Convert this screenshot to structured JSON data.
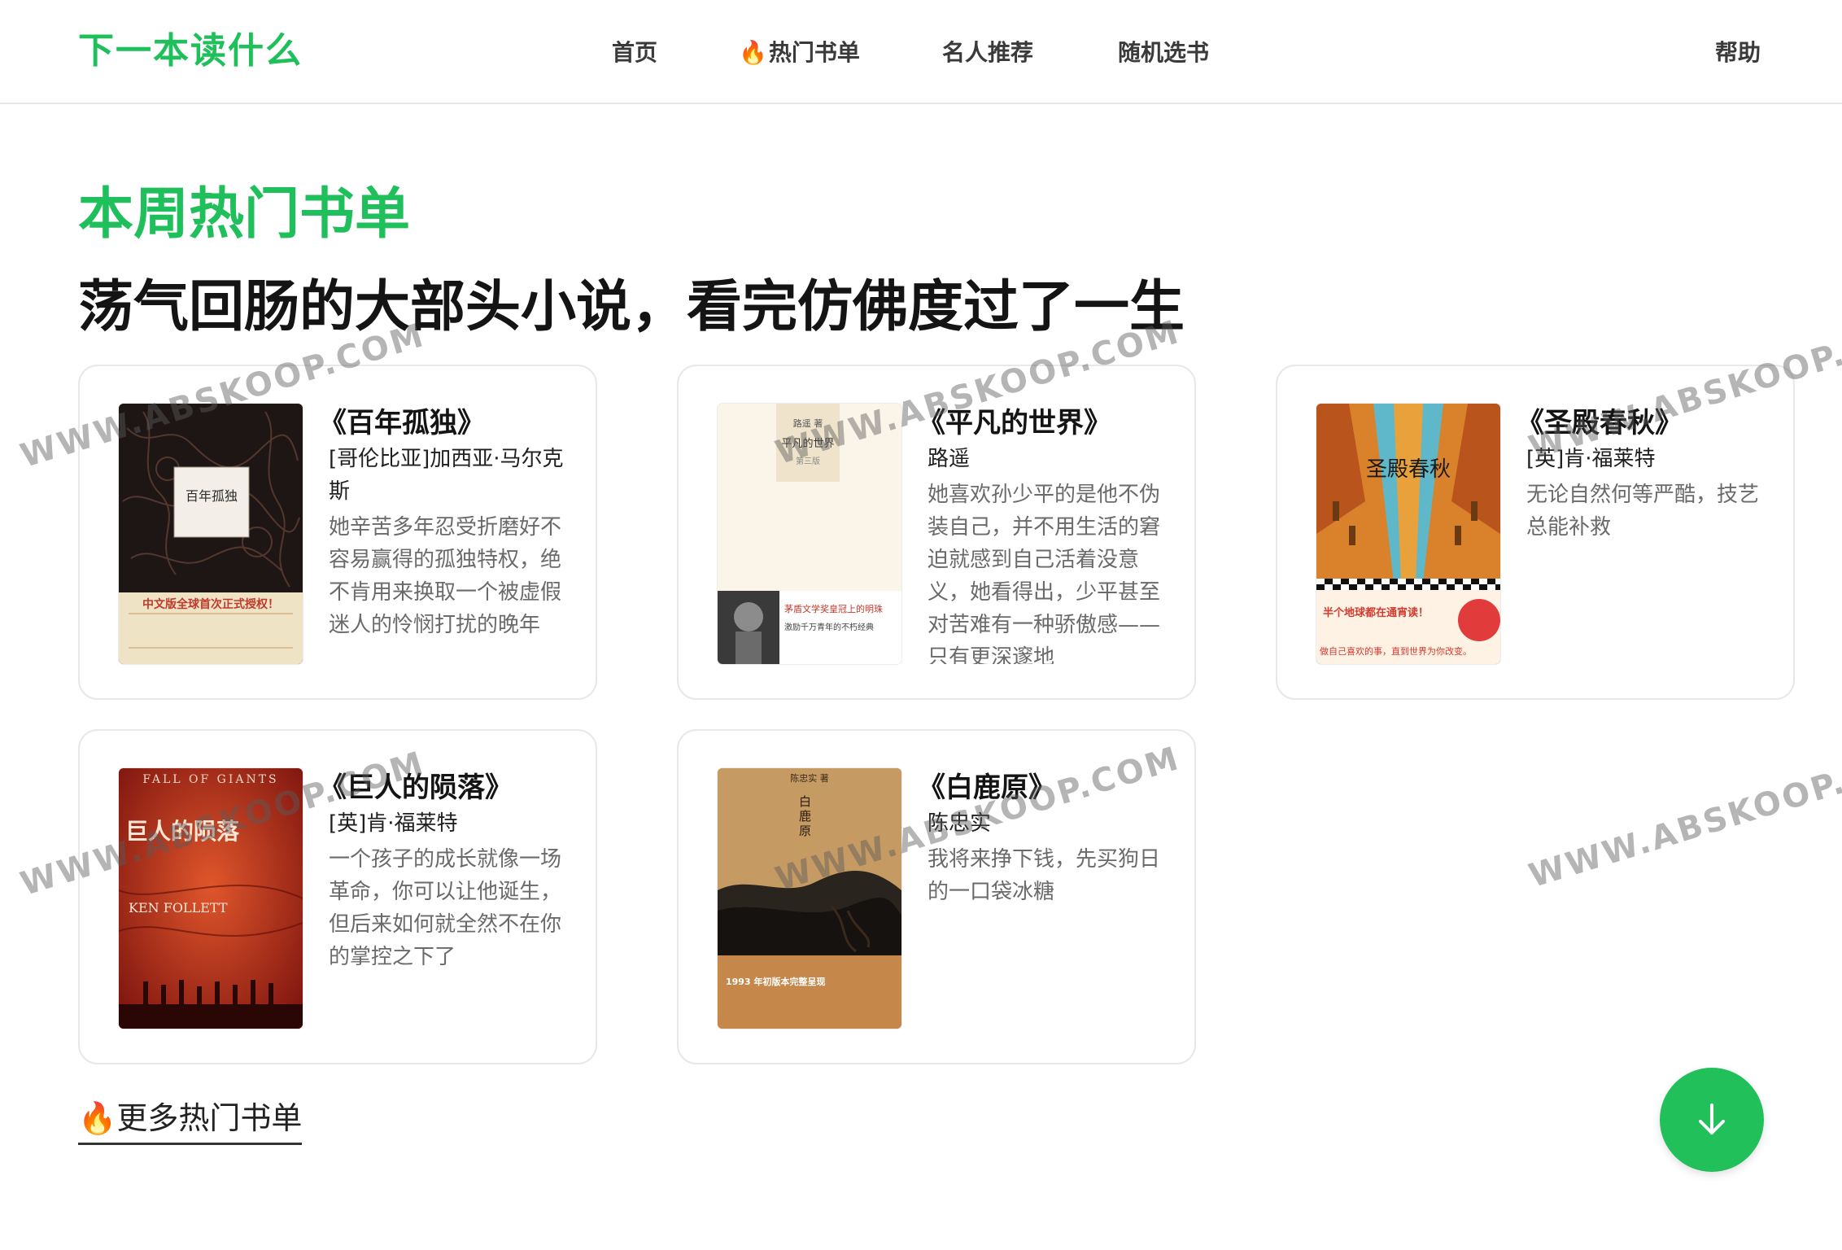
{
  "header": {
    "logo": "下一本读什么",
    "nav": [
      {
        "label": "首页"
      },
      {
        "label": "热门书单",
        "icon": "fire-icon"
      },
      {
        "label": "名人推荐"
      },
      {
        "label": "随机选书"
      }
    ],
    "help": "帮助"
  },
  "main": {
    "title": "本周热门书单",
    "subtitle": "荡气回肠的大部头小说，看完仿佛度过了一生",
    "books": [
      {
        "title": "《百年孤独》",
        "author": "[哥伦比亚]加西亚·马尔克斯",
        "desc": "她辛苦多年忍受折磨好不容易赢得的孤独特权，绝不肯用来换取一个被虚假迷人的怜悯打扰的晚年",
        "cover": {
          "title": "百年孤独",
          "banner": "中文版全球首次正式授权！",
          "bg": "#1d1614",
          "band": "#efe3c6"
        }
      },
      {
        "title": "《平凡的世界》",
        "author": "路遥",
        "desc": "她喜欢孙少平的是他不伪装自己，并不用生活的窘迫就感到自己活着没意义，她看得出，少平甚至对苦难有一种骄傲感——只有更深邃地",
        "cover": {
          "title": "平凡的世界",
          "author_line": "路遥 著",
          "edition": "第三版",
          "tag1": "茅盾文学奖皇冠上的明珠",
          "tag2": "激励千万青年的不朽经典",
          "bg": "#fbf4e8"
        }
      },
      {
        "title": "《圣殿春秋》",
        "author": "[英]肯·福莱特",
        "desc": "无论自然何等严酷，技艺总能补救",
        "cover": {
          "title": "圣殿春秋",
          "tag1": "半个地球都在通宵读！",
          "tag2": "做自己喜欢的事，直到世界为你改变。",
          "bg": "#5fb8c9"
        }
      },
      {
        "title": "《巨人的陨落》",
        "author": "[英]肯·福莱特",
        "desc": "一个孩子的成长就像一场革命，你可以让他诞生，但后来如何就全然不在你的掌控之下了",
        "cover": {
          "top": "FALL OF GIANTS",
          "title": "巨人的陨落",
          "brand": "KEN FOLLETT",
          "bg": "#b8291e"
        }
      },
      {
        "title": "《白鹿原》",
        "author": "陈忠实",
        "desc": "我将来挣下钱，先买狗日的一口袋冰糖",
        "cover": {
          "author_line": "陈忠实 著",
          "title": "白鹿原",
          "tag": "1993 年初版本完整呈现",
          "bg": "#b98a4f"
        }
      }
    ],
    "more_label": "更多热门书单"
  },
  "watermark": "WWW.ABSKOOP.COM",
  "colors": {
    "brand_green": "#1fbf5b",
    "fire_orange": "#f26b1d"
  }
}
